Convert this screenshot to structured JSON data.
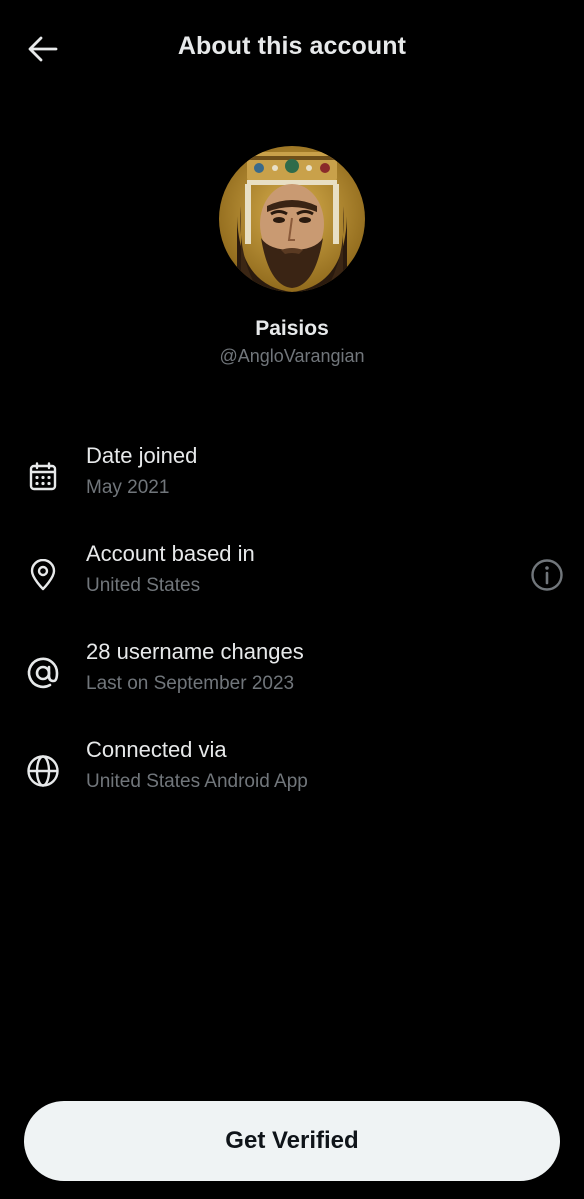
{
  "header": {
    "back_icon": "arrow-left-icon",
    "title": "About this account"
  },
  "profile": {
    "display_name": "Paisios",
    "handle": "@AngloVarangian"
  },
  "rows": [
    {
      "icon": "calendar-icon",
      "title": "Date joined",
      "subtitle": "May 2021"
    },
    {
      "icon": "location-pin-icon",
      "title": "Account based in",
      "subtitle": "United States",
      "trailing_icon": "info-icon"
    },
    {
      "icon": "at-sign-icon",
      "title": "28 username changes",
      "subtitle": "Last on September 2023"
    },
    {
      "icon": "globe-icon",
      "title": "Connected via",
      "subtitle": "United States Android App"
    }
  ],
  "footer": {
    "verify_label": "Get Verified"
  },
  "colors": {
    "background": "#000000",
    "primary_text": "#e7e9ea",
    "secondary_text": "#71767b",
    "button_bg": "#eff3f4",
    "button_text": "#0f1419"
  }
}
